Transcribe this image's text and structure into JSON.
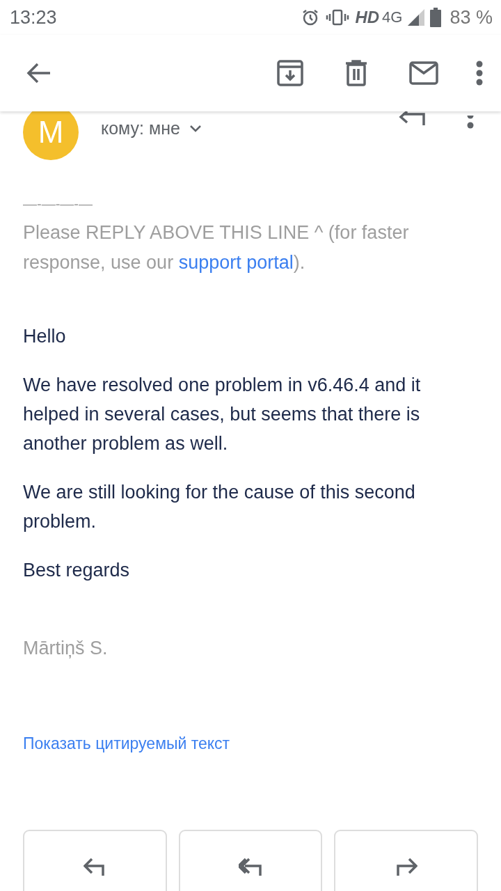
{
  "status_bar": {
    "time": "13:23",
    "network": "HD",
    "network_type": "4G",
    "battery": "83 %"
  },
  "sender": {
    "avatar_letter": "M",
    "recipient": "кому: мне"
  },
  "body": {
    "separator": "—-—-—-—",
    "notice": "Please REPLY ABOVE THIS LINE ^ (for faster response, use our ",
    "notice_link": "support portal",
    "notice_end": ").",
    "paragraphs": [
      "Hello",
      "We have resolved one problem in v6.46.4 and it helped in several cases, but seems that there is another problem as well.",
      "We are still looking for the cause of this second problem.",
      "Best regards"
    ],
    "signature": "Mārtiņš S."
  },
  "show_quoted": "Показать цитируемый текст",
  "actions": [
    {
      "kind": "reply"
    },
    {
      "kind": "reply_all"
    },
    {
      "kind": "forward"
    }
  ]
}
